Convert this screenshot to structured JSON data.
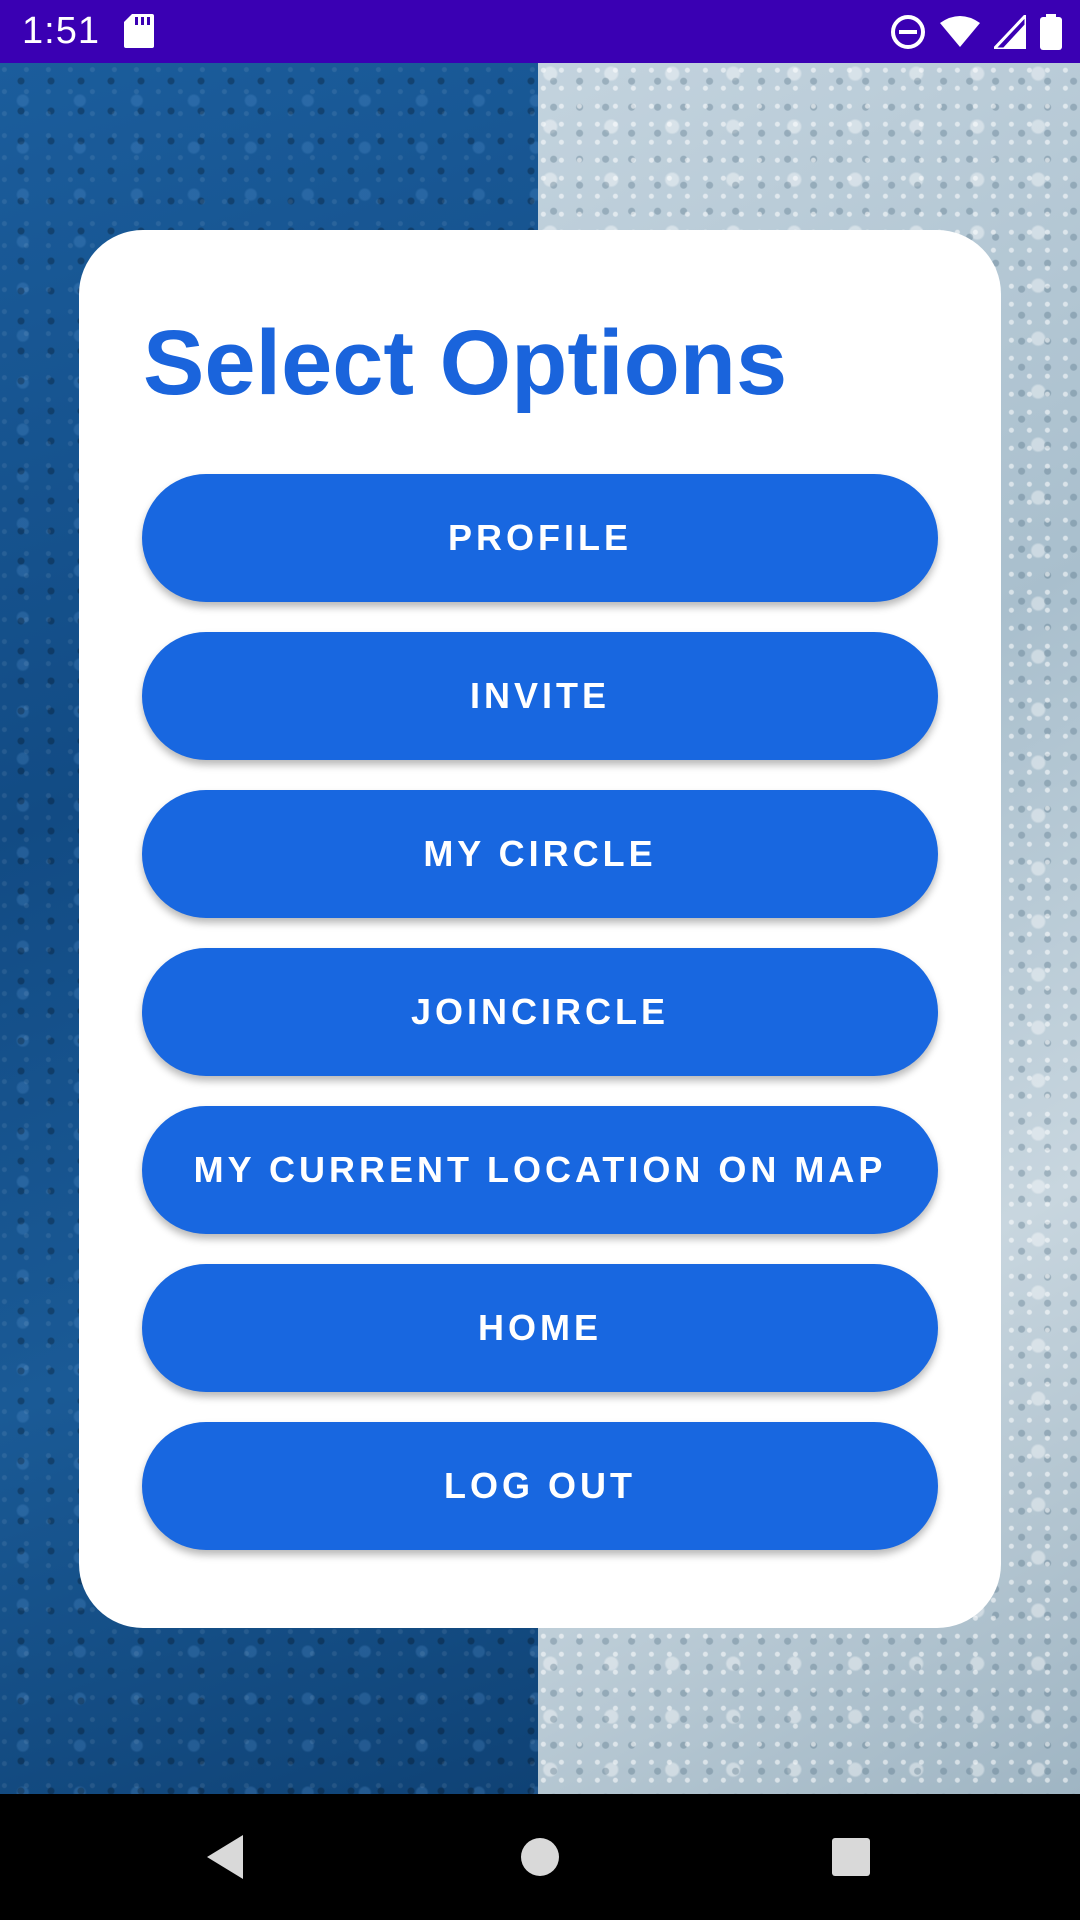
{
  "status_bar": {
    "time": "1:51",
    "icons": [
      "sd-card-icon",
      "do-not-disturb-icon",
      "wifi-icon",
      "cellular-signal-icon",
      "battery-icon"
    ]
  },
  "main": {
    "title": "Select Options",
    "buttons": [
      {
        "label": "PROFILE"
      },
      {
        "label": "INVITE"
      },
      {
        "label": "MY CIRCLE"
      },
      {
        "label": "JOINCIRCLE"
      },
      {
        "label": "MY CURRENT LOCATION ON MAP"
      },
      {
        "label": "HOME"
      },
      {
        "label": "LOG OUT"
      }
    ]
  },
  "nav_bar": {
    "icons": [
      "back-icon",
      "home-icon",
      "recents-icon"
    ]
  },
  "colors": {
    "status_bar": "#3a00b3",
    "accent": "#1867e0",
    "title": "#1a64dc",
    "card": "#ffffff"
  }
}
